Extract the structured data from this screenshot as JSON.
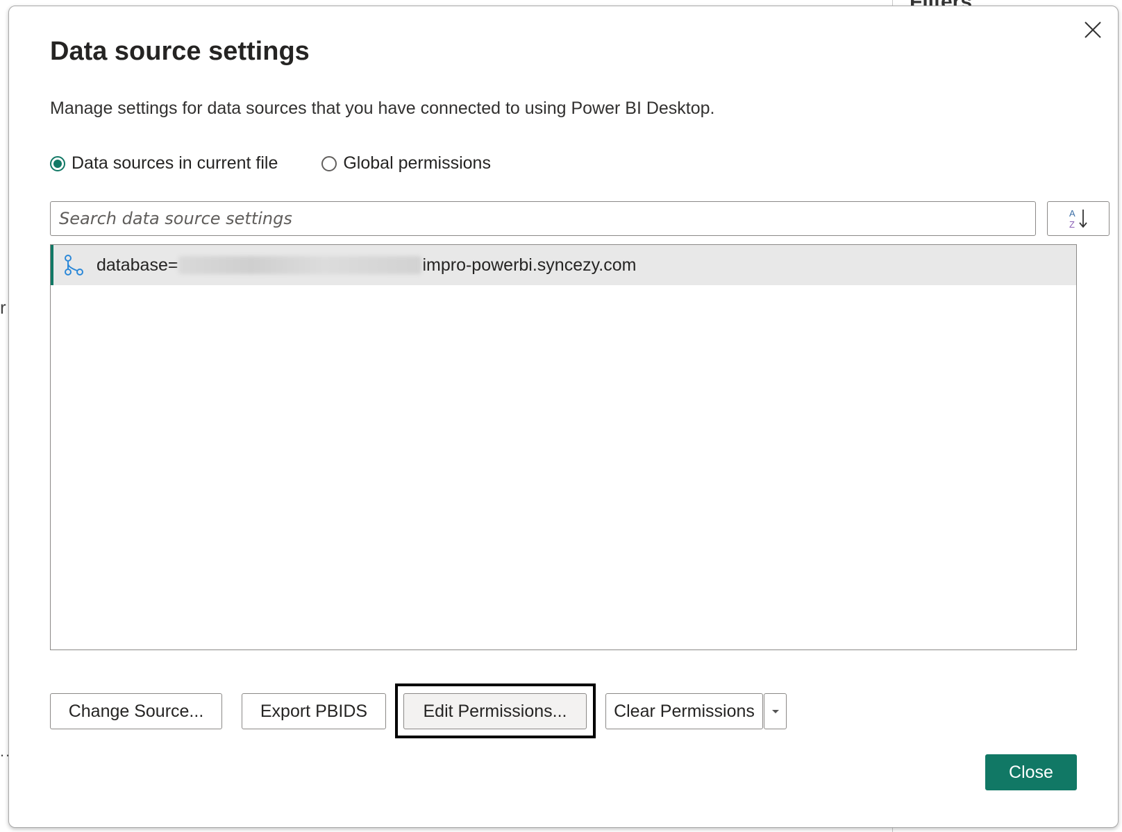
{
  "background": {
    "right_panel_tab": "Filters",
    "left_glyph": "r",
    "left_dots": ".."
  },
  "dialog": {
    "title": "Data source settings",
    "subtitle": "Manage settings for data sources that you have connected to using Power BI Desktop.",
    "scope_options": [
      {
        "label": "Data sources in current file",
        "selected": true
      },
      {
        "label": "Global permissions",
        "selected": false
      }
    ],
    "search": {
      "placeholder": "Search data source settings",
      "value": ""
    },
    "sort_icon": "sort-az-icon",
    "data_sources": [
      {
        "icon": "database-connection-icon",
        "label_prefix": "database=",
        "label_suffix": "impro-powerbi.syncezy.com",
        "redacted": true,
        "selected": true
      }
    ],
    "buttons": {
      "change_source": "Change Source...",
      "export_pbids": "Export PBIDS",
      "edit_permissions": "Edit Permissions...",
      "clear_permissions": "Clear Permissions",
      "close": "Close"
    },
    "colors": {
      "accent": "#117865",
      "selected_row": "#e8e8e8",
      "border": "#8a8886"
    }
  }
}
